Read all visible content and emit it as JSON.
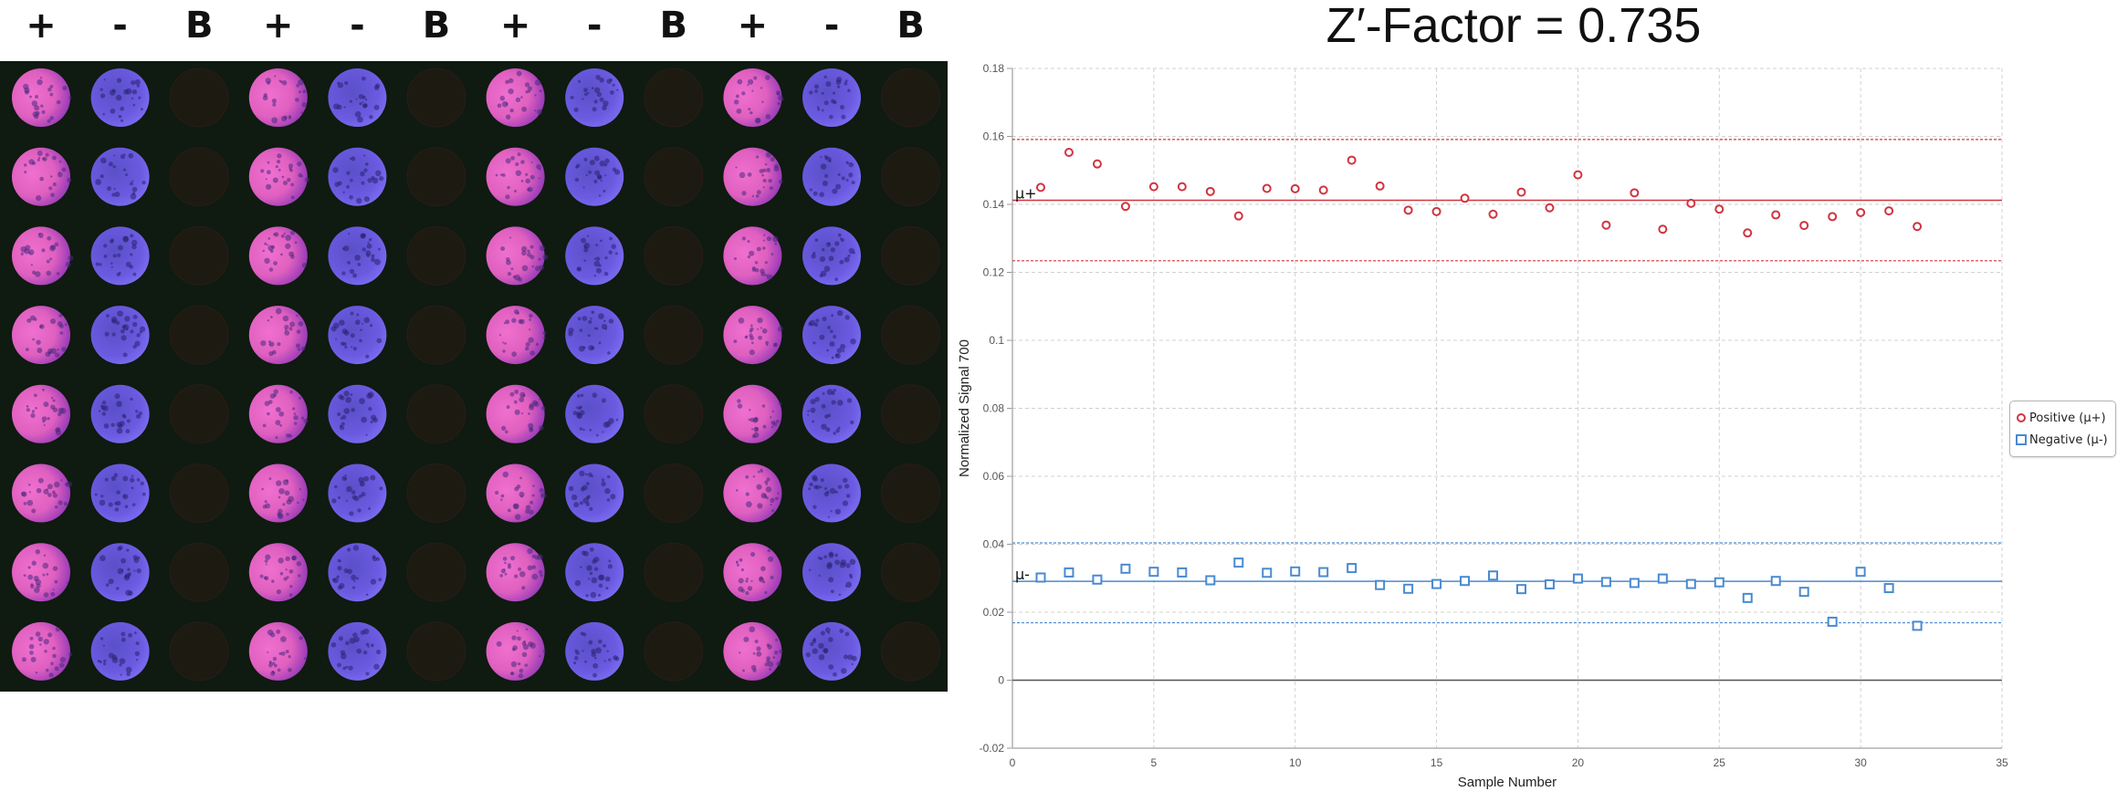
{
  "plate": {
    "column_labels": [
      "+",
      "-",
      "B",
      "+",
      "-",
      "B",
      "+",
      "-",
      "B",
      "+",
      "-",
      "B"
    ],
    "rows": 8,
    "well_types": {
      "+": "positive",
      "-": "negative",
      "B": "blank"
    },
    "colors": {
      "positive": "#e060c0",
      "negative": "#6a5ae0",
      "blank": "#2a1a14",
      "background": "#0f1a10"
    }
  },
  "colors": {
    "positive": "#d0343f",
    "negative": "#4a8ad0",
    "zero_line": "#555555",
    "grid": "#d0d0d0"
  },
  "chart_data": {
    "type": "scatter",
    "title": "Z′-Factor = 0.735",
    "xlabel": "Sample Number",
    "ylabel": "Normalized Signal 700",
    "xlim": [
      0,
      35
    ],
    "ylim": [
      -0.02,
      0.18
    ],
    "x_ticks": [
      0,
      5,
      10,
      15,
      20,
      25,
      30,
      35
    ],
    "x_tick_labels": [
      "0",
      "5",
      "10",
      "15",
      "20",
      "25",
      "30",
      "35"
    ],
    "y_ticks": [
      -0.02,
      0,
      0.02,
      0.04,
      0.06,
      0.08,
      0.1,
      0.12,
      0.14,
      0.16,
      0.18
    ],
    "y_tick_labels": [
      "-0.02",
      "0",
      "0.02",
      "0.04",
      "0.06",
      "0.08",
      "0.1",
      "0.12",
      "0.14",
      "0.16",
      "0.18"
    ],
    "grid": true,
    "legend_position": "right",
    "x": [
      1,
      2,
      3,
      4,
      5,
      6,
      7,
      8,
      9,
      10,
      11,
      12,
      13,
      14,
      15,
      16,
      17,
      18,
      19,
      20,
      21,
      22,
      23,
      24,
      25,
      26,
      27,
      28,
      29,
      30,
      31,
      32
    ],
    "series": [
      {
        "name": "Positive (μ+)",
        "marker": "circle",
        "color": "#d0343f",
        "mean_label": "μ+",
        "mean": 0.1412,
        "upper_limit": 0.1591,
        "lower_limit": 0.1234,
        "values": [
          0.145,
          0.1553,
          0.1519,
          0.1394,
          0.1452,
          0.1452,
          0.1438,
          0.1366,
          0.1447,
          0.1446,
          0.1442,
          0.153,
          0.1454,
          0.1383,
          0.1379,
          0.1418,
          0.1371,
          0.1436,
          0.139,
          0.1487,
          0.1339,
          0.1434,
          0.1327,
          0.1403,
          0.1386,
          0.1316,
          0.1369,
          0.1338,
          0.1364,
          0.1376,
          0.1381,
          0.1335
        ]
      },
      {
        "name": "Negative (μ-)",
        "marker": "square",
        "color": "#4a8ad0",
        "mean_label": "μ-",
        "mean": 0.0291,
        "upper_limit": 0.0404,
        "lower_limit": 0.0169,
        "values": [
          0.0302,
          0.0317,
          0.0296,
          0.0328,
          0.0319,
          0.0317,
          0.0294,
          0.0346,
          0.0316,
          0.032,
          0.0318,
          0.033,
          0.028,
          0.0269,
          0.0283,
          0.0292,
          0.0308,
          0.0268,
          0.0282,
          0.0299,
          0.0289,
          0.0286,
          0.0299,
          0.0283,
          0.0288,
          0.0242,
          0.0292,
          0.026,
          0.0172,
          0.0319,
          0.0271,
          0.016
        ]
      }
    ],
    "reference_lines": [
      {
        "value": 0,
        "style": "solid",
        "color": "#555555"
      }
    ]
  }
}
